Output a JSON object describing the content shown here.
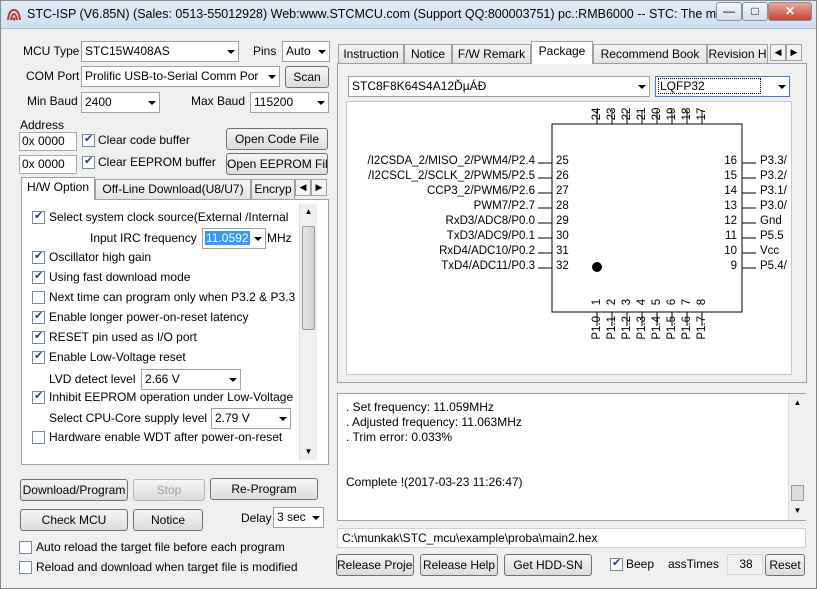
{
  "window": {
    "title": "STC-ISP (V6.85N) (Sales: 0513-55012928) Web:www.STCMCU.com  (Support QQ:800003751)  pc.:RMB6000 -- STC: The most p...",
    "min": "—",
    "max": "□",
    "close": "✕"
  },
  "left": {
    "mcu_type_label": "MCU Type",
    "mcu_type": "STC15W408AS",
    "pins_label": "Pins",
    "pins": "Auto",
    "com_port_label": "COM Port",
    "com_port": "Prolific USB-to-Serial Comm Por",
    "scan": "Scan",
    "min_baud_label": "Min Baud",
    "min_baud": "2400",
    "max_baud_label": "Max Baud",
    "max_baud": "115200",
    "address_label": "Address",
    "addr1": "0x 0000",
    "addr2": "0x 0000",
    "clear_code": "Clear code buffer",
    "clear_eeprom": "Clear EEPROM buffer",
    "open_code": "Open Code File",
    "open_eeprom": "Open EEPROM File",
    "tabs": [
      "H/W Option",
      "Off-Line Download(U8/U7)",
      "Encryp"
    ],
    "options": [
      {
        "label": "Select system clock source(External /Internal",
        "checked": true
      },
      {
        "label": "Oscillator high gain",
        "checked": true
      },
      {
        "label": "Using fast download mode",
        "checked": true
      },
      {
        "label": "Next time can program only when P3.2 & P3.3",
        "checked": false
      },
      {
        "label": "Enable longer power-on-reset latency",
        "checked": true
      },
      {
        "label": "RESET pin used as I/O port",
        "checked": true
      },
      {
        "label": "Enable Low-Voltage reset",
        "checked": true
      },
      {
        "label": "Inhibit EEPROM operation under Low-Voltage",
        "checked": true
      },
      {
        "label": "Hardware enable WDT after power-on-reset",
        "checked": false
      }
    ],
    "irc_label": "Input IRC frequency",
    "irc_value": "11.0592",
    "irc_unit": "MHz",
    "lvd_label": "LVD detect level",
    "lvd_value": "2.66 V",
    "core_label": "Select CPU-Core supply level",
    "core_value": "2.79 V",
    "download": "Download/Program",
    "stop": "Stop",
    "reprogram": "Re-Program",
    "check_mcu": "Check MCU",
    "notice": "Notice",
    "delay_label": "Delay",
    "delay": "3 sec",
    "auto_reload": "Auto reload the target file before each program",
    "reload_download": "Reload and download when target file is modified"
  },
  "right": {
    "tabs": [
      "Instruction",
      "Notice",
      "F/W Remark",
      "Package",
      "Recommend Book",
      "Revision H"
    ],
    "active_tab": "Package",
    "chip_select": "STC8F8K64S4A12ĎµÁĐ",
    "package_select": "LQFP32",
    "top_pins": [
      "24",
      "23",
      "22",
      "21",
      "20",
      "19",
      "18",
      "17"
    ],
    "bottom_pins": [
      "1",
      "2",
      "3",
      "4",
      "5",
      "6",
      "7",
      "8"
    ],
    "bottom_labels": [
      "P1.0",
      "P1.1",
      "P1.2",
      "P1.3",
      "P1.4",
      "P1.5",
      "P1.6",
      "P1.7"
    ],
    "left_pins": [
      {
        "name": "/I2CSDA_2/MISO_2/PWM4/P2.4",
        "num": "25"
      },
      {
        "name": "/I2CSCL_2/SCLK_2/PWM5/P2.5",
        "num": "26"
      },
      {
        "name": "CCP3_2/PWM6/P2.6",
        "num": "27"
      },
      {
        "name": "PWM7/P2.7",
        "num": "28"
      },
      {
        "name": "RxD3/ADC8/P0.0",
        "num": "29"
      },
      {
        "name": "TxD3/ADC9/P0.1",
        "num": "30"
      },
      {
        "name": "RxD4/ADC10/P0.2",
        "num": "31"
      },
      {
        "name": "TxD4/ADC11/P0.3",
        "num": "32"
      }
    ],
    "right_pins": [
      {
        "name": "P3.3/",
        "num": "16"
      },
      {
        "name": "P3.2/",
        "num": "15"
      },
      {
        "name": "P3.1/",
        "num": "14"
      },
      {
        "name": "P3.0/",
        "num": "13"
      },
      {
        "name": "Gnd",
        "num": "12"
      },
      {
        "name": "P5.5",
        "num": "11"
      },
      {
        "name": "Vcc",
        "num": "10"
      },
      {
        "name": "P5.4/",
        "num": "9"
      }
    ],
    "log": [
      ". Set frequency: 11.059MHz",
      ". Adjusted frequency: 11.063MHz",
      ". Trim error: 0.033%",
      "",
      "",
      "Complete !(2017-03-23 11:26:47)"
    ],
    "path": "C:\\munkak\\STC_mcu\\example\\proba\\main2.hex",
    "release_project": "Release Project",
    "release_help": "Release Help",
    "get_hdd": "Get HDD-SN",
    "beep": "Beep",
    "pass_label": "assTimes",
    "pass_value": "38",
    "reset": "Reset"
  }
}
